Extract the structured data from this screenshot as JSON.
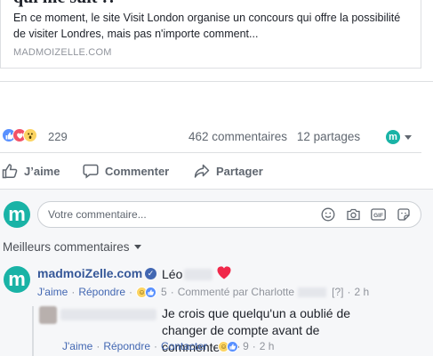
{
  "card": {
    "title": "qui me suit !?",
    "description": "En ce moment, le site Visit London organise un concours qui offre la possibilité de visiter Londres, mais pas n'importe comment...",
    "domain": "MADMOIZELLE.COM"
  },
  "reactions": {
    "count": "229",
    "types": [
      "like-icon",
      "love-icon",
      "wow-icon"
    ],
    "comments": "462 commentaires",
    "shares": "12 partages"
  },
  "actions": {
    "like": "J’aime",
    "comment": "Commenter",
    "share": "Partager"
  },
  "composer": {
    "placeholder": "Votre commentaire...",
    "avatar_letter": "m"
  },
  "sort": {
    "label": "Meilleurs commentaires"
  },
  "top_comment": {
    "author": "madmoiZelle.com",
    "text": "Léo",
    "like": "J'aime",
    "reply": "Répondre",
    "reaction_count": "5",
    "commented_by": "Commenté par Charlotte",
    "bracket": "[?]",
    "time": "2 h"
  },
  "reply_comment": {
    "text": "Je crois que quelqu'un a oublié de changer de compte avant de commenter ^^",
    "like": "J'aime",
    "reply": "Répondre",
    "contact": "Contacter",
    "reaction_count": "9",
    "time": "2 h"
  },
  "colors": {
    "brand": "#19b3a6",
    "link": "#365899",
    "muted": "#606770"
  }
}
